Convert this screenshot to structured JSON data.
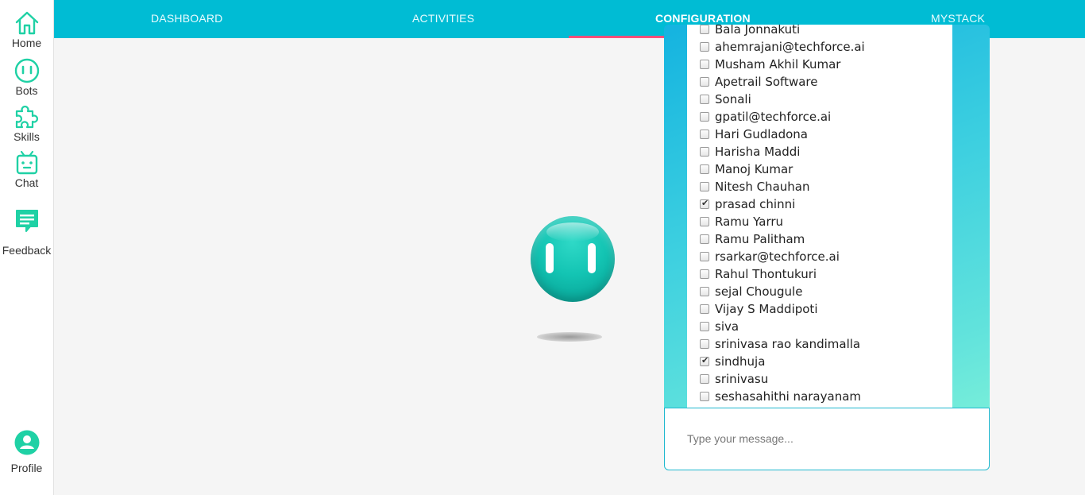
{
  "sidebar": {
    "items": [
      {
        "label": "Home",
        "icon": "home-icon"
      },
      {
        "label": "Bots",
        "icon": "bot-face-icon"
      },
      {
        "label": "Skills",
        "icon": "puzzle-icon"
      },
      {
        "label": "Chat",
        "icon": "chat-robot-icon"
      },
      {
        "label": "Feedback",
        "icon": "feedback-icon"
      }
    ],
    "profile": {
      "label": "Profile",
      "icon": "profile-icon"
    },
    "accent_color": "#1fd1a5"
  },
  "topnav": {
    "tabs": [
      {
        "label": "DASHBOARD",
        "active": false
      },
      {
        "label": "ACTIVITIES",
        "active": false
      },
      {
        "label": "CONFIGURATION",
        "active": true
      },
      {
        "label": "MYSTACK",
        "active": false
      }
    ],
    "background": "#00bcd4",
    "active_underline_color": "#ff4f7a"
  },
  "chat": {
    "users": [
      {
        "name": "Bala Jonnakuti",
        "checked": false
      },
      {
        "name": "ahemrajani@techforce.ai",
        "checked": false
      },
      {
        "name": "Musham Akhil Kumar",
        "checked": false
      },
      {
        "name": "Apetrail Software",
        "checked": false
      },
      {
        "name": "Sonali",
        "checked": false
      },
      {
        "name": "gpatil@techforce.ai",
        "checked": false
      },
      {
        "name": "Hari Gudladona",
        "checked": false
      },
      {
        "name": "Harisha Maddi",
        "checked": false
      },
      {
        "name": "Manoj Kumar",
        "checked": false
      },
      {
        "name": "Nitesh Chauhan",
        "checked": false
      },
      {
        "name": "prasad chinni",
        "checked": true
      },
      {
        "name": "Ramu Yarru",
        "checked": false
      },
      {
        "name": "Ramu Palitham",
        "checked": false
      },
      {
        "name": "rsarkar@techforce.ai",
        "checked": false
      },
      {
        "name": "Rahul Thontukuri",
        "checked": false
      },
      {
        "name": "sejal Chougule",
        "checked": false
      },
      {
        "name": "Vijay S Maddipoti",
        "checked": false
      },
      {
        "name": "siva",
        "checked": false
      },
      {
        "name": "srinivasa rao kandimalla",
        "checked": false
      },
      {
        "name": "sindhuja",
        "checked": true
      },
      {
        "name": "srinivasu",
        "checked": false
      },
      {
        "name": "seshasahithi narayanam",
        "checked": false
      }
    ],
    "message_placeholder": "Type your message...",
    "message_value": ""
  }
}
